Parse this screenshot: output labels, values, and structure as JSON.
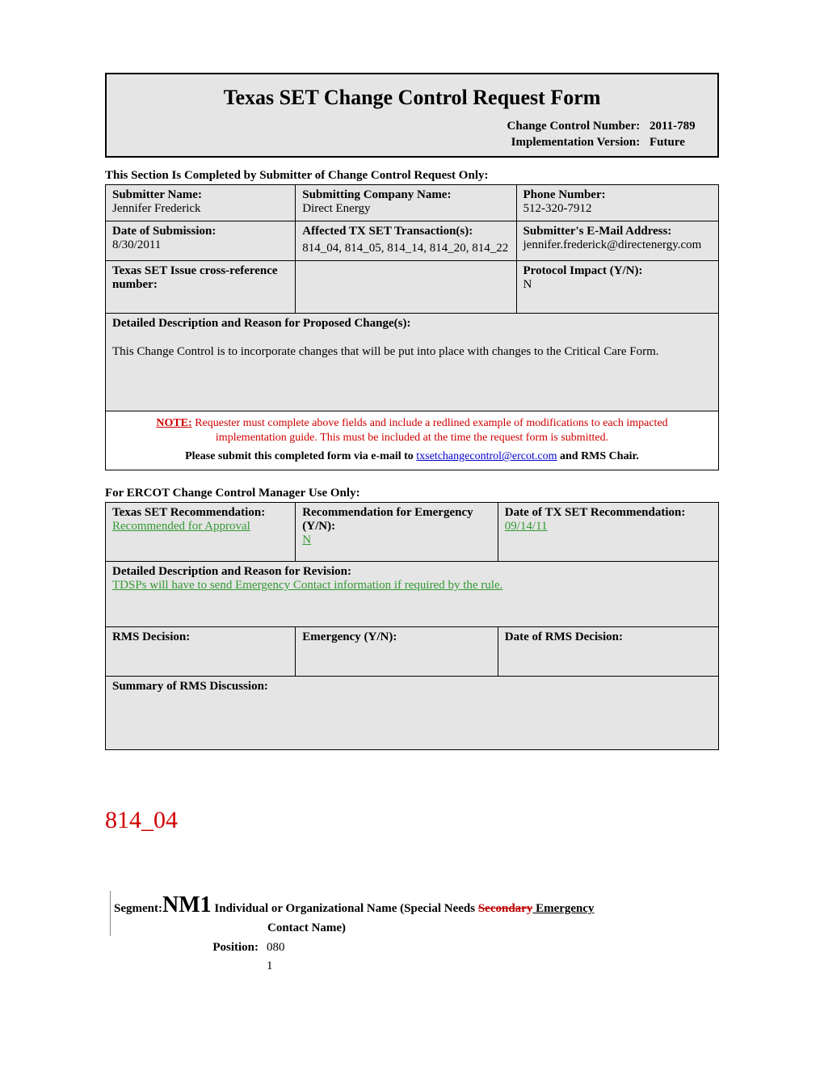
{
  "header": {
    "title": "Texas SET Change Control Request Form",
    "cc_label": "Change Control Number:",
    "cc_value": "2011-789",
    "impl_label": "Implementation Version:",
    "impl_value": "Future"
  },
  "section1_label": "This Section Is Completed by Submitter of Change Control Request Only:",
  "submitter": {
    "name_lbl": "Submitter Name:",
    "name_val": "Jennifer Frederick",
    "company_lbl": "Submitting Company Name:",
    "company_val": "Direct Energy",
    "phone_lbl": "Phone Number:",
    "phone_val": " 512-320-7912",
    "date_lbl": "Date of Submission:",
    "date_val": "8/30/2011",
    "txset_lbl": "Affected TX SET Transaction(s):",
    "txset_val": "814_04, 814_05, 814_14, 814_20, 814_22",
    "email_lbl": "Submitter's E-Mail Address:",
    "email_val": "jennifer.frederick@directenergy.com",
    "xref_lbl": "Texas SET Issue cross-reference number:",
    "xref_val": "",
    "proto_lbl": "Protocol Impact (Y/N):",
    "proto_val": "N"
  },
  "detail": {
    "lbl": "Detailed Description and Reason for Proposed Change(s):",
    "val": "This Change Control is to incorporate changes that will be put into place with changes to the Critical Care Form."
  },
  "note": {
    "prefix": "NOTE:",
    "text": " Requester must complete above fields and include a redlined example of modifications to each impacted implementation guide.  This must be included at the time the request form is submitted.",
    "submit_prefix": "Please submit this completed form via e-mail to ",
    "submit_link": "txsetchangecontrol@ercot.com",
    "submit_suffix": " and RMS Chair."
  },
  "section2_label": "For ERCOT Change Control Manager Use Only:",
  "ercot": {
    "rec_lbl": "Texas SET Recommendation:",
    "rec_val": "Recommended for Approval",
    "emerg_lbl": "Recommendation for Emergency (Y/N):",
    "emerg_val": "N",
    "date_lbl": "Date of TX SET Recommendation:",
    "date_val": "09/14/11",
    "rev_lbl": "Detailed Description and Reason for Revision:",
    "rev_val": "TDSPs will have to send Emergency Contact information if required by the rule.",
    "rms_dec_lbl": "RMS Decision:",
    "rms_emerg_lbl": "Emergency (Y/N):",
    "rms_date_lbl": "Date of RMS Decision:",
    "rms_sum_lbl": "Summary of RMS Discussion:"
  },
  "segment": {
    "heading": "814_04",
    "seg_lbl": "Segment:",
    "seg_code": "NM1",
    "seg_desc_pre": " Individual or Organizational Name (Special Needs ",
    "seg_strike": "Secondary",
    "seg_ins": " Emergency",
    "seg_desc_post": " Contact Name)",
    "pos_lbl": "Position:",
    "pos_val": "080"
  },
  "page_number": "1"
}
